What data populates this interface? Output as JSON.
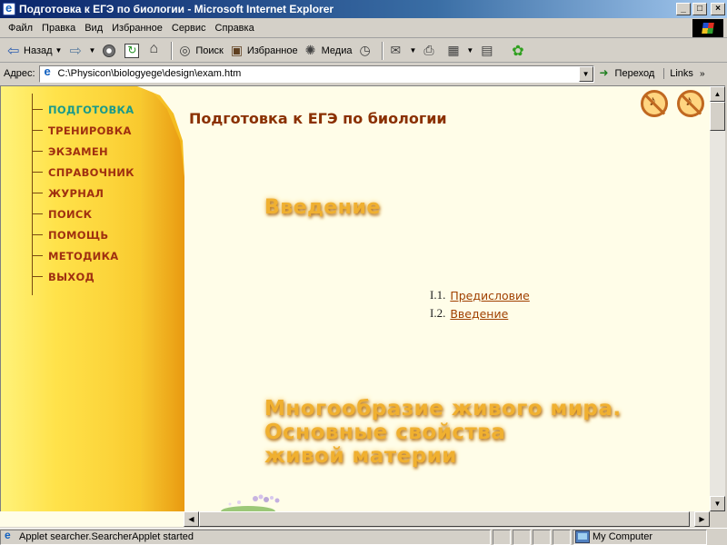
{
  "window": {
    "title": "Подготовка к ЕГЭ по биологии - Microsoft Internet Explorer",
    "buttons": [
      "_",
      "□",
      "×"
    ]
  },
  "menu": [
    "Файл",
    "Правка",
    "Вид",
    "Избранное",
    "Сервис",
    "Справка"
  ],
  "toolbar": {
    "back": "Назад",
    "search": "Поиск",
    "favorites": "Избранное",
    "media": "Медиа"
  },
  "address": {
    "label": "Адрес:",
    "url": "C:\\Physicon\\biologyege\\design\\exam.htm",
    "go": "Переход",
    "links": "Links"
  },
  "page": {
    "title": "Подготовка к ЕГЭ по биологии",
    "nav": [
      {
        "label": "ПОДГОТОВКА",
        "active": true
      },
      {
        "label": "ТРЕНИРОВКА",
        "active": false
      },
      {
        "label": "ЭКЗАМЕН",
        "active": false
      },
      {
        "label": "СПРАВОЧНИК",
        "active": false
      },
      {
        "label": "ЖУРНАЛ",
        "active": false
      },
      {
        "label": "ПОИСК",
        "active": false
      },
      {
        "label": "ПОМОЩЬ",
        "active": false
      },
      {
        "label": "МЕТОДИКА",
        "active": false
      },
      {
        "label": "ВЫХОД",
        "active": false
      }
    ],
    "section_intro": "Введение",
    "toc": [
      {
        "num": "I.1.",
        "label": "Предисловие"
      },
      {
        "num": "I.2.",
        "label": "Введение"
      }
    ],
    "section_diversity": [
      "Многообразие живого мира.",
      "Основные свойства",
      "живой материи"
    ]
  },
  "status": {
    "text": "Applet searcher.SearcherApplet started",
    "zone": "My Computer"
  },
  "colors": {
    "nav_text": "#a03010",
    "nav_active": "#1a9a8a",
    "title": "#8a3000",
    "heading": "#f0b030",
    "link": "#a04000",
    "content_bg": "#fffde8"
  }
}
